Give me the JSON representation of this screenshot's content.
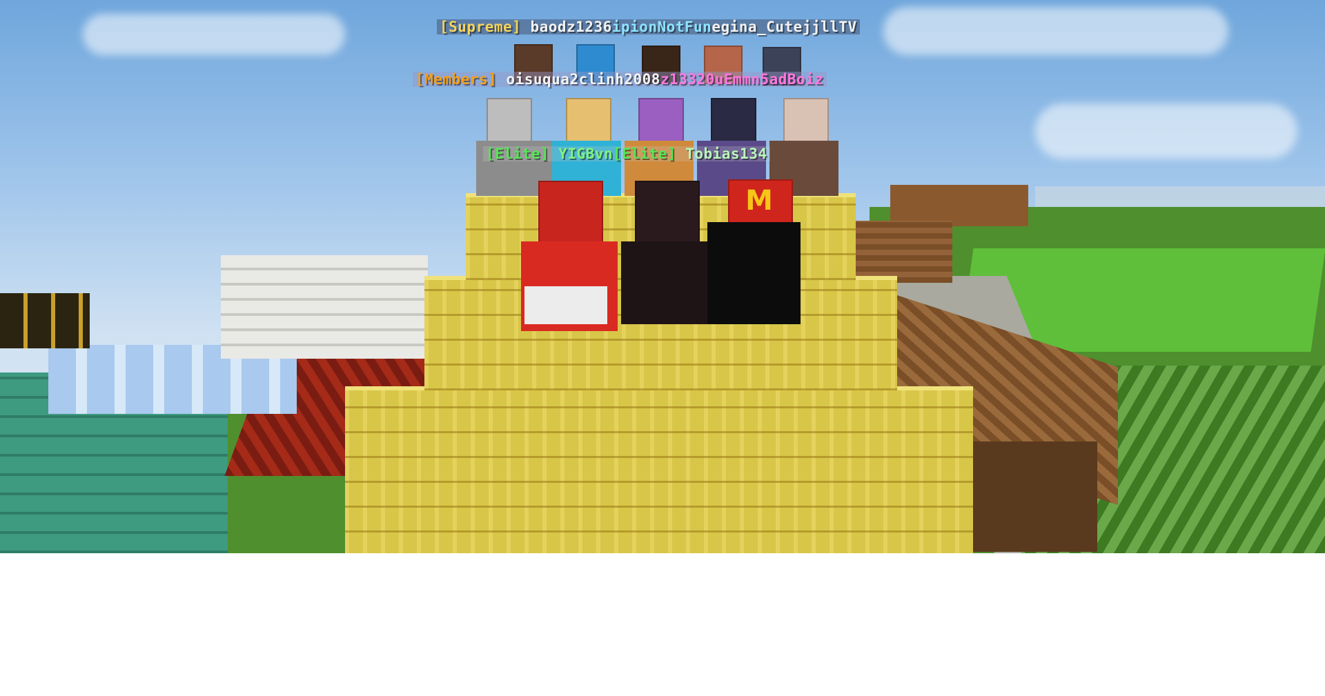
{
  "nametags": {
    "supreme": {
      "rank": "[Supreme]",
      "players": [
        "baodz1236",
        "ipionNotFun",
        "egina_CutejjllTV"
      ]
    },
    "members": {
      "rank": "[Members]",
      "players": [
        "oisuqua2",
        "clinh2008",
        "z13320",
        "uEmm",
        "n5adBoiz"
      ]
    },
    "elite": {
      "rank1": "[Elite]",
      "player1": "YIGBvn",
      "rank2": "[Elite]",
      "player2": "Tobias134"
    }
  },
  "sign_glyph": "M",
  "colors": {
    "hay": "#d8c648",
    "sky_top": "#6fa6dc",
    "grass": "#4f8f2e",
    "prismarine": "#3f9b80",
    "nether": "#7a1c12",
    "wood": "#8a5a2e",
    "rank_supreme": "#f4d35e",
    "rank_members": "#f4a01c",
    "rank_elite": "#55e655"
  }
}
